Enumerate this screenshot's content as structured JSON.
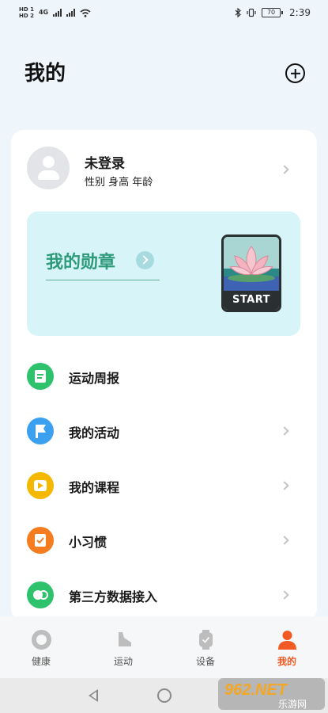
{
  "status_bar": {
    "sim1": "HD 1",
    "sim2": "HD 2",
    "net": "4G",
    "battery": "70",
    "time": "2:39"
  },
  "header": {
    "title": "我的",
    "add_icon": "plus-circle-icon"
  },
  "profile": {
    "name": "未登录",
    "subtitle": "性别 身高 年龄"
  },
  "medals": {
    "title": "我的勋章",
    "badge_label": "START"
  },
  "menu": {
    "items": [
      {
        "label": "运动周报",
        "icon": "report-icon",
        "color": "#2dc26b"
      },
      {
        "label": "我的活动",
        "icon": "flag-icon",
        "color": "#3ba0f0"
      },
      {
        "label": "我的课程",
        "icon": "play-icon",
        "color": "#f5b800"
      },
      {
        "label": "小习惯",
        "icon": "checkmark-icon",
        "color": "#f57c1f"
      },
      {
        "label": "第三方数据接入",
        "icon": "link-icon",
        "color": "#2dc26b"
      }
    ]
  },
  "bottom_nav": {
    "items": [
      {
        "label": "健康",
        "icon": "health-ring-icon"
      },
      {
        "label": "运动",
        "icon": "shoe-icon"
      },
      {
        "label": "设备",
        "icon": "watch-icon"
      },
      {
        "label": "我的",
        "icon": "person-icon",
        "active": true
      }
    ]
  },
  "colors": {
    "accent": "#f15a24",
    "medal_text": "#2d9a7a",
    "medal_bg": "#d7f4f8"
  },
  "watermark": {
    "brand": "962.NET",
    "site": "乐游网"
  }
}
